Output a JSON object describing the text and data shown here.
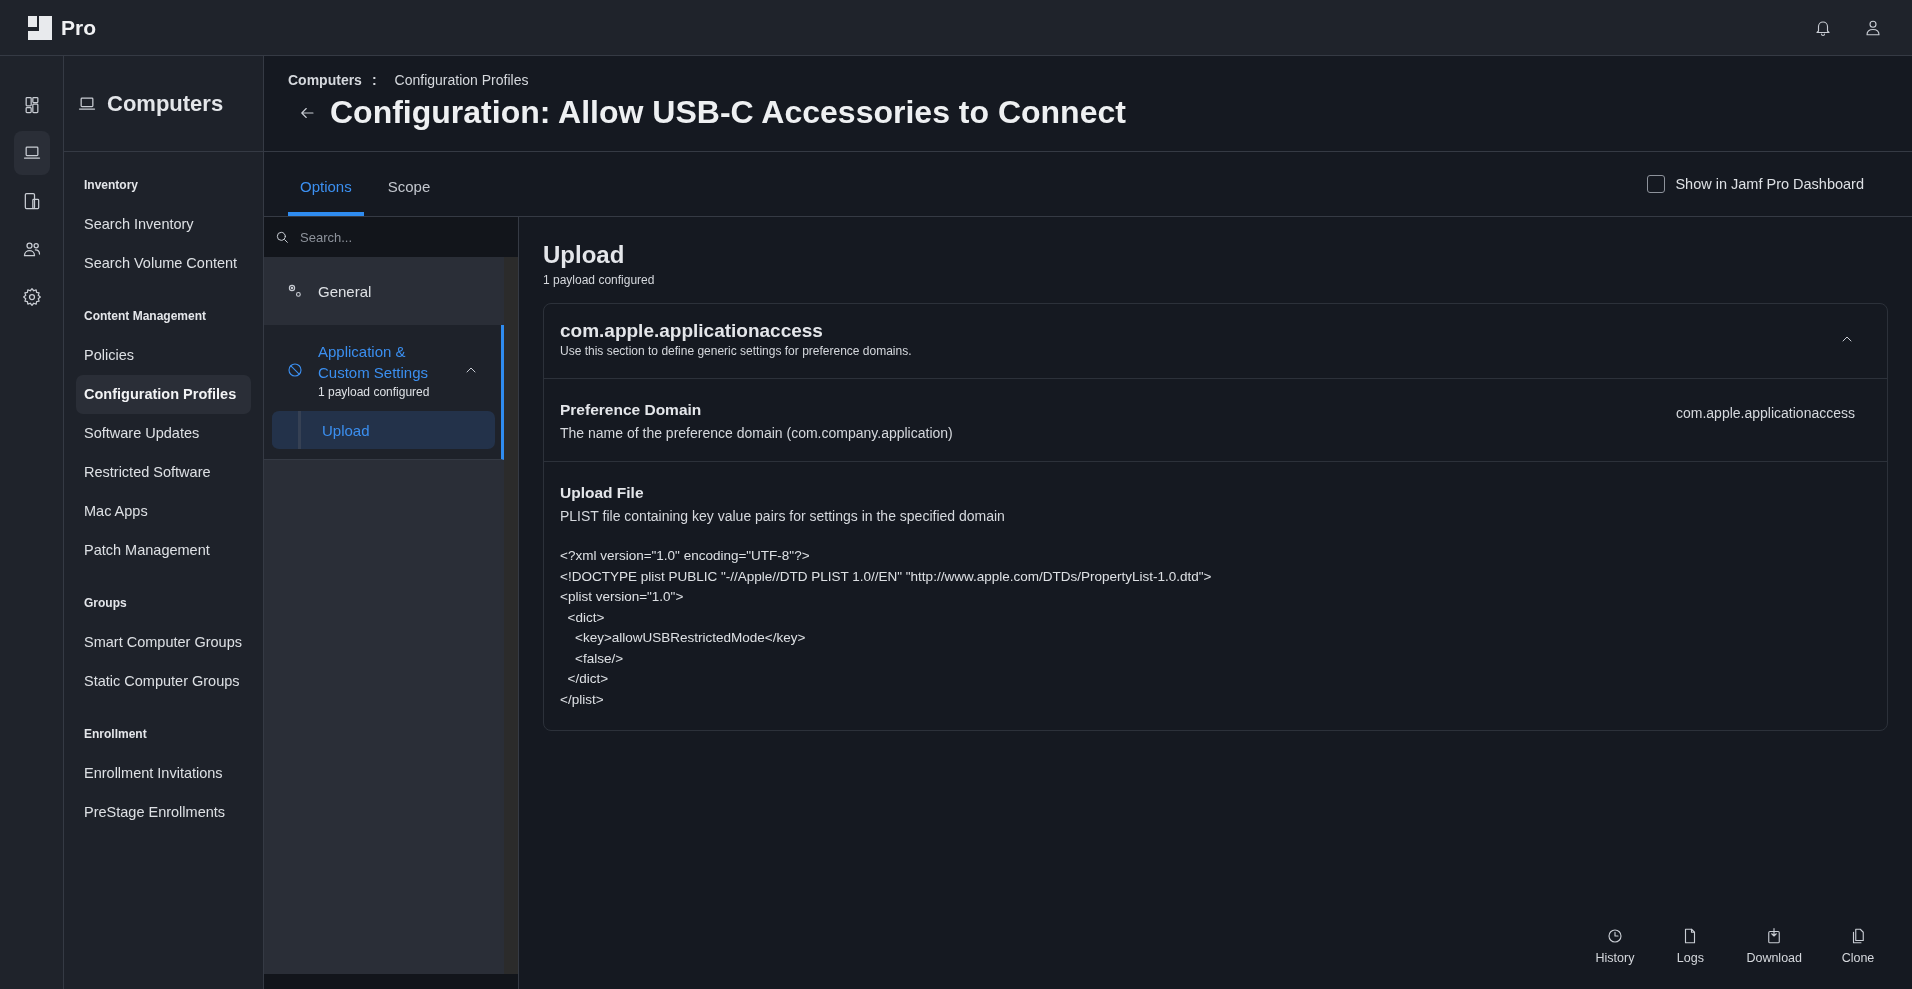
{
  "app": {
    "logo_text": "Pro"
  },
  "rail": [
    {
      "selected": false
    },
    {
      "selected": true
    },
    {
      "selected": false
    },
    {
      "selected": false
    },
    {
      "selected": false
    }
  ],
  "sidebar": {
    "title": "Computers",
    "sections": [
      {
        "heading": "Inventory",
        "items": [
          {
            "label": "Search Inventory",
            "selected": false
          },
          {
            "label": "Search Volume Content",
            "selected": false
          }
        ]
      },
      {
        "heading": "Content Management",
        "items": [
          {
            "label": "Policies",
            "selected": false
          },
          {
            "label": "Configuration Profiles",
            "selected": true
          },
          {
            "label": "Software Updates",
            "selected": false
          },
          {
            "label": "Restricted Software",
            "selected": false
          },
          {
            "label": "Mac Apps",
            "selected": false
          },
          {
            "label": "Patch Management",
            "selected": false
          }
        ]
      },
      {
        "heading": "Groups",
        "items": [
          {
            "label": "Smart Computer Groups",
            "selected": false
          },
          {
            "label": "Static Computer Groups",
            "selected": false
          }
        ]
      },
      {
        "heading": "Enrollment",
        "items": [
          {
            "label": "Enrollment Invitations",
            "selected": false
          },
          {
            "label": "PreStage Enrollments",
            "selected": false
          }
        ]
      }
    ]
  },
  "breadcrumb": {
    "items": [
      "Computers",
      "Configuration Profiles"
    ],
    "separator": ":"
  },
  "title": "Configuration: Allow USB-C Accessories to Connect",
  "tabs": [
    {
      "label": "Options",
      "selected": true
    },
    {
      "label": "Scope",
      "selected": false
    }
  ],
  "dashboard_checkbox": {
    "label": "Show in Jamf Pro Dashboard",
    "checked": false
  },
  "payload_search": {
    "placeholder": "Search..."
  },
  "payloads": [
    {
      "label": "General",
      "selected": false
    },
    {
      "label": "Application & Custom Settings",
      "subtitle": "1 payload configured",
      "selected": true,
      "expanded": true,
      "children": [
        {
          "label": "Upload",
          "selected": true
        }
      ]
    }
  ],
  "content": {
    "title": "Upload",
    "subtitle": "1 payload configured",
    "card": {
      "title": "com.apple.applicationaccess",
      "description": "Use this section to define generic settings for preference domains.",
      "expanded": true,
      "fields": [
        {
          "kind": "text",
          "label": "Preference Domain",
          "description": "The name of the preference domain (com.company.application)",
          "value": "com.apple.applicationaccess"
        },
        {
          "kind": "file",
          "label": "Upload File",
          "description": "PLIST file containing key value pairs for settings in the specified domain",
          "lines": [
            "<?xml version=\"1.0\" encoding=\"UTF-8\"?>",
            "<!DOCTYPE plist PUBLIC \"-//Apple//DTD PLIST 1.0//EN\" \"http://www.apple.com/DTDs/PropertyList-1.0.dtd\">",
            "<plist version=\"1.0\">",
            "  <dict>",
            "    <key>allowUSBRestrictedMode</key>",
            "    <false/>",
            "  </dict>",
            "</plist>"
          ]
        }
      ]
    }
  },
  "actions": [
    {
      "label": "History"
    },
    {
      "label": "Logs"
    },
    {
      "label": "Download"
    },
    {
      "label": "Clone"
    }
  ]
}
